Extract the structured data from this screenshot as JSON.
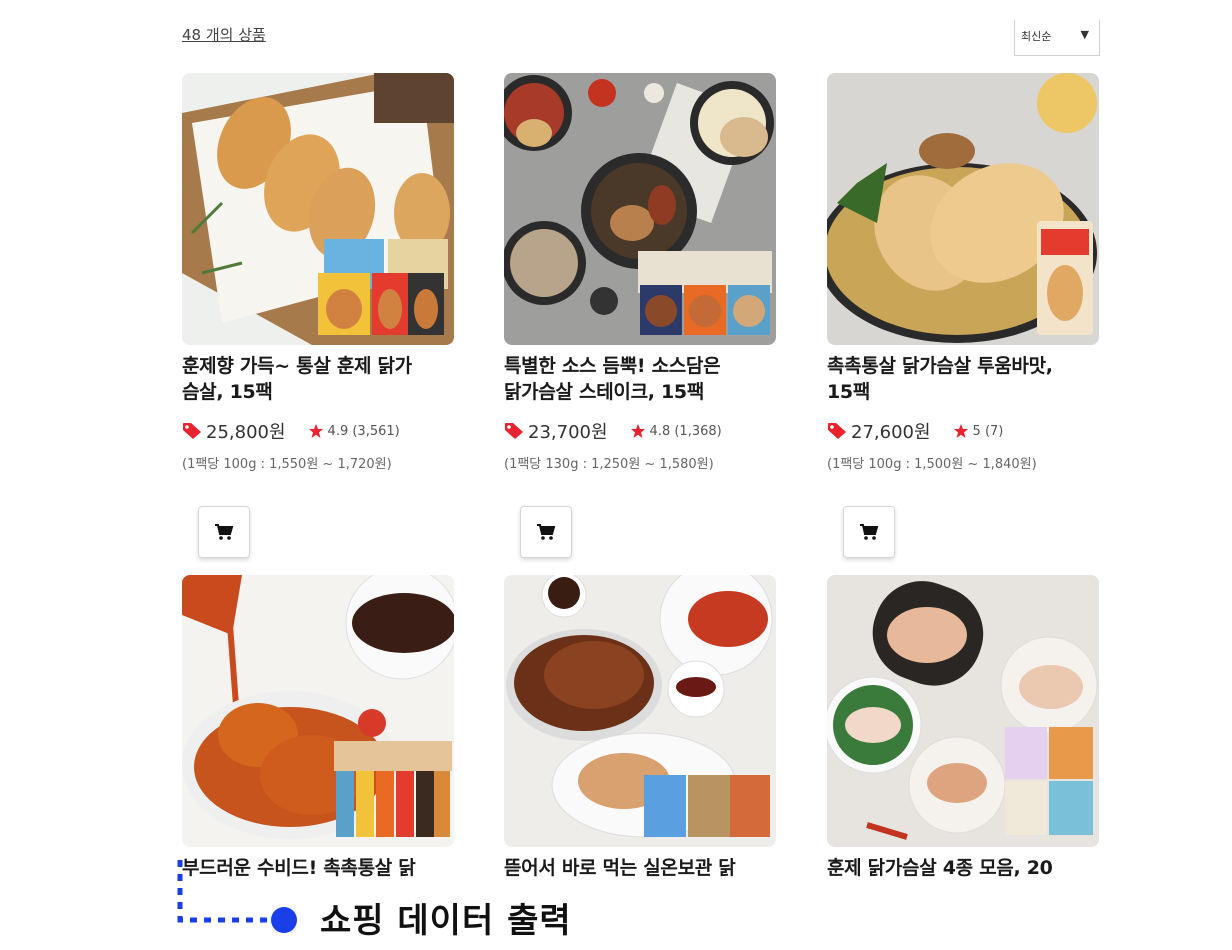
{
  "header": {
    "product_count": "48 개의 상품",
    "sort_value": "최신순"
  },
  "products": [
    {
      "title_line1": "훈제향 가득~ 통살 훈제 닭가",
      "title_line2": "슴살, 15팩",
      "price": "25,800원",
      "rating": "4.9 (3,561)",
      "unit_price": "(1팩당 100g : 1,550원 ~ 1,720원)"
    },
    {
      "title_line1": "특별한 소스 듬뿍! 소스담은",
      "title_line2": "닭가슴살 스테이크, 15팩",
      "price": "23,700원",
      "rating": "4.8 (1,368)",
      "unit_price": "(1팩당 130g : 1,250원 ~ 1,580원)"
    },
    {
      "title_line1": "촉촉통살 닭가슴살 투움바맛,",
      "title_line2": "15팩",
      "price": "27,600원",
      "rating": "5 (7)",
      "unit_price": "(1팩당 100g : 1,500원 ~ 1,840원)"
    },
    {
      "title_line1": "부드러운 수비드! 촉촉통살 닭"
    },
    {
      "title_line1": "뜯어서 바로 먹는 실온보관 닭"
    },
    {
      "title_line1": "훈제 닭가슴살 4종 모음, 20"
    }
  ],
  "annotation": {
    "label": "쇼핑 데이터 출력"
  },
  "colors": {
    "accent_red": "#e8232f",
    "annotation_blue": "#1a3ee8"
  }
}
